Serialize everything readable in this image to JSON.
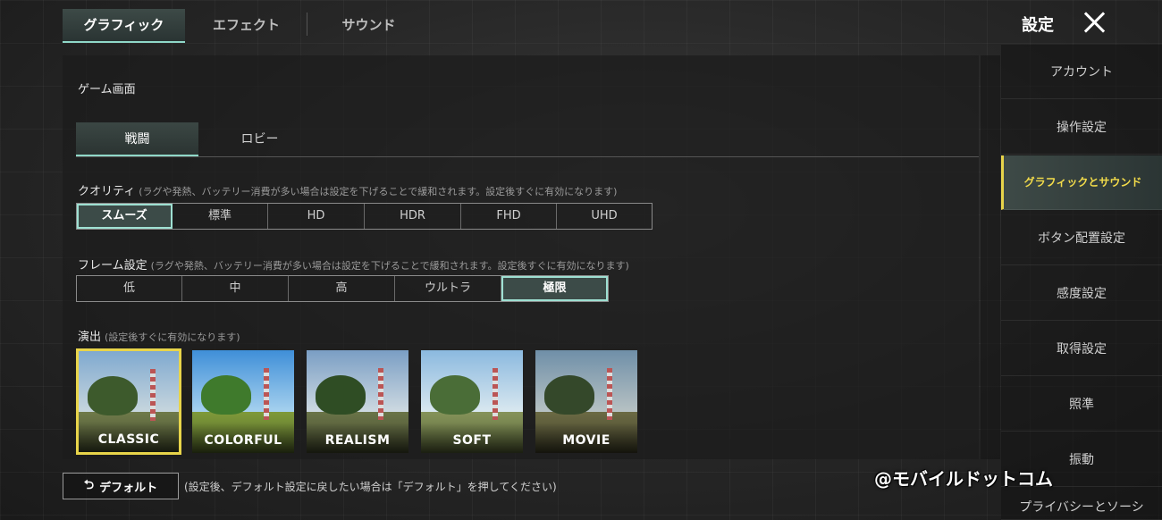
{
  "top_tabs": [
    "グラフィック",
    "エフェクト",
    "サウンド"
  ],
  "header": {
    "title": "設定"
  },
  "section_title": "ゲーム画面",
  "sub_tabs": [
    "戦闘",
    "ロビー"
  ],
  "quality": {
    "label": "クオリティ",
    "hint": "(ラグや発熱、バッテリー消費が多い場合は設定を下げることで緩和されます。設定後すぐに有効になります)",
    "options": [
      "スムーズ",
      "標準",
      "HD",
      "HDR",
      "FHD",
      "UHD"
    ],
    "selected": "スムーズ"
  },
  "frame": {
    "label": "フレーム設定",
    "hint": "(ラグや発熱、バッテリー消費が多い場合は設定を下げることで緩和されます。設定後すぐに有効になります)",
    "options": [
      "低",
      "中",
      "高",
      "ウルトラ",
      "極限"
    ],
    "selected": "極限"
  },
  "style": {
    "label": "演出",
    "hint": "(設定後すぐに有効になります)",
    "options": [
      "CLASSIC",
      "COLORFUL",
      "REALISM",
      "SOFT",
      "MOVIE"
    ],
    "selected": "CLASSIC"
  },
  "default_button": {
    "label": "デフォルト",
    "icon": "undo-icon"
  },
  "default_hint": "(設定後、デフォルト設定に戻したい場合は「デフォルト」を押してください)",
  "sidebar": {
    "items": [
      "アカウント",
      "操作設定",
      "グラフィックとサウンド",
      "ボタン配置設定",
      "感度設定",
      "取得設定",
      "照準",
      "振動",
      "プライバシーとソーシ"
    ],
    "active": "グラフィックとサウンド"
  },
  "watermark": "@モバイルドットコム",
  "colors": {
    "accent": "#8fd8c8",
    "highlight": "#e8d44a"
  }
}
